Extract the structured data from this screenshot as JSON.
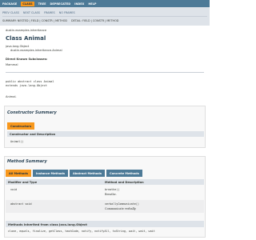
{
  "topnav": {
    "items": [
      {
        "label": "PACKAGE",
        "active": false
      },
      {
        "label": "CLASS",
        "active": true
      },
      {
        "label": "TREE",
        "active": false
      },
      {
        "label": "DEPRECATED",
        "active": false
      },
      {
        "label": "INDEX",
        "active": false
      },
      {
        "label": "HELP",
        "active": false
      }
    ]
  },
  "subnav": {
    "row1": [
      "PREV CLASS",
      "NEXT CLASS",
      "FRAMES",
      "NO FRAMES"
    ],
    "row2": [
      "SUMMARY: NESTED | FIELD | CONSTR | METHOD",
      "DETAIL: FIELD | CONSTR | METHOD"
    ]
  },
  "header": {
    "package": "dustin.examples.inheritance",
    "title": "Class Animal"
  },
  "inheritance": {
    "parent": "java.lang.Object",
    "child": "dustin.examples.inheritance.Animal"
  },
  "subclasses": {
    "heading": "Direct Known Subclasses:",
    "value": "Mammal"
  },
  "signature": {
    "line1": "public abstract class Animal",
    "line2": "extends java.lang.Object"
  },
  "description": "Animal.",
  "constructor_summary": {
    "title": "Constructor Summary",
    "tab": "Constructors",
    "header": "Constructor and Description",
    "rows": [
      {
        "name": "Animal()"
      }
    ]
  },
  "method_summary": {
    "title": "Method Summary",
    "tabs": [
      "All Methods",
      "Instance Methods",
      "Abstract Methods",
      "Concrete Methods"
    ],
    "headers": [
      "Modifier and Type",
      "Method and Description"
    ],
    "rows": [
      {
        "modifier": "void",
        "method": "breathe()",
        "desc": "Breathe."
      },
      {
        "modifier": "abstract void",
        "method": "verballyCommunicate()",
        "desc": "Communicate verbally."
      }
    ]
  },
  "inherited": {
    "title": "Methods inherited from class java.lang.Object",
    "list": "clone, equals, finalize, getClass, hashCode, notify, notifyAll, toString, wait, wait, wait"
  },
  "colors": {
    "nav": "#4d7a97",
    "accent": "#f8981d",
    "subnav": "#dee3e9"
  }
}
